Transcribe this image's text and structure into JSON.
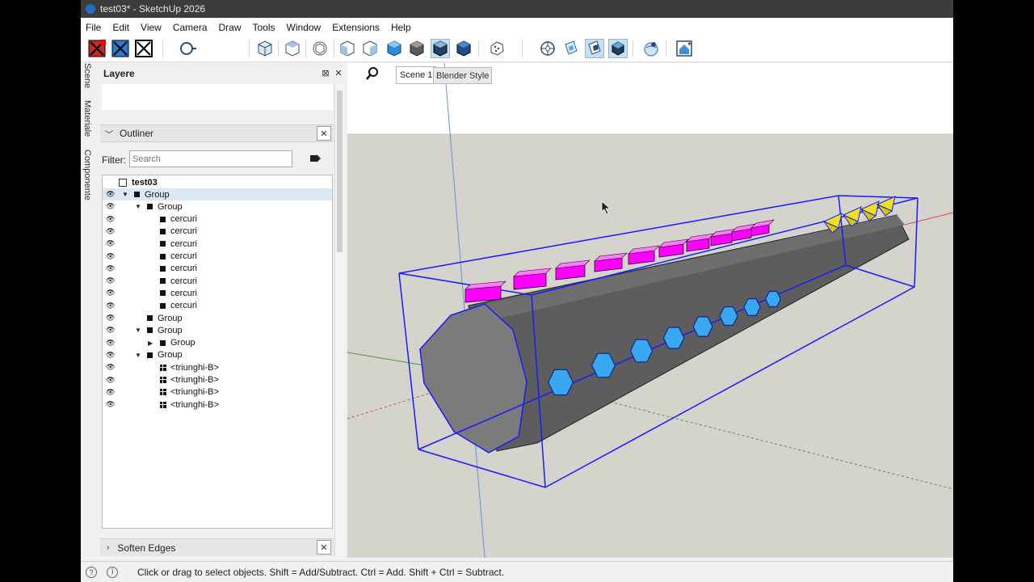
{
  "window": {
    "title": "test03* - SketchUp 2026"
  },
  "menu": [
    "File",
    "Edit",
    "View",
    "Camera",
    "Draw",
    "Tools",
    "Window",
    "Extensions",
    "Help"
  ],
  "toolbar": {
    "icons": [
      "xray-red-icon",
      "xray-blue-icon",
      "xray-black-icon",
      "orbit-icon",
      "iso-view-icon",
      "top-view-icon",
      "front-view-icon",
      "right-view-icon",
      "back-view-icon",
      "left-view-icon",
      "bottom-view-icon",
      "wireframe-style-icon",
      "shaded-style-icon",
      "textured-style-icon",
      "monochrome-style-icon",
      "section-plane-icon",
      "display-section-icon",
      "section-cut-icon",
      "section-fill-icon",
      "geo-location-icon",
      "warehouse-icon"
    ]
  },
  "sidetabs": [
    "Scene",
    "Materiale",
    "Componente"
  ],
  "tray": {
    "layers_title": "Layere",
    "outliner_title": "Outliner",
    "filter_label": "Filter:",
    "filter_placeholder": "Search",
    "soften_title": "Soften Edges",
    "close_glyph": "✕",
    "pin_glyph": "⊠"
  },
  "outliner": {
    "root": "test03",
    "rows": [
      {
        "label": "Group",
        "depth": 0,
        "twisty": "open",
        "icon": "group",
        "selected": true
      },
      {
        "label": "Group",
        "depth": 1,
        "twisty": "open",
        "icon": "group"
      },
      {
        "label": "cercuri",
        "depth": 2,
        "twisty": "none",
        "icon": "group"
      },
      {
        "label": "cercuri",
        "depth": 2,
        "twisty": "none",
        "icon": "group"
      },
      {
        "label": "cercuri",
        "depth": 2,
        "twisty": "none",
        "icon": "group"
      },
      {
        "label": "cercuri",
        "depth": 2,
        "twisty": "none",
        "icon": "group"
      },
      {
        "label": "cercuri",
        "depth": 2,
        "twisty": "none",
        "icon": "group"
      },
      {
        "label": "cercuri",
        "depth": 2,
        "twisty": "none",
        "icon": "group"
      },
      {
        "label": "cercuri",
        "depth": 2,
        "twisty": "none",
        "icon": "group"
      },
      {
        "label": "cercuri",
        "depth": 2,
        "twisty": "none",
        "icon": "group"
      },
      {
        "label": "Group",
        "depth": 1,
        "twisty": "none",
        "icon": "group"
      },
      {
        "label": "Group",
        "depth": 1,
        "twisty": "open",
        "icon": "group"
      },
      {
        "label": "Group",
        "depth": 2,
        "twisty": "closed",
        "icon": "group"
      },
      {
        "label": "Group",
        "depth": 1,
        "twisty": "open",
        "icon": "group"
      },
      {
        "label": "<triunghi-B>",
        "depth": 2,
        "twisty": "none",
        "icon": "component"
      },
      {
        "label": "<triunghi-B>",
        "depth": 2,
        "twisty": "none",
        "icon": "component"
      },
      {
        "label": "<triunghi-B>",
        "depth": 2,
        "twisty": "none",
        "icon": "component"
      },
      {
        "label": "<triunghi-B>",
        "depth": 2,
        "twisty": "none",
        "icon": "component"
      }
    ]
  },
  "scenes": {
    "tabs": [
      "Scene 1",
      "Blender Style"
    ],
    "active": "Scene 1"
  },
  "model": {
    "colors": {
      "sky": "#ffffff",
      "ground": "#d4d4cc",
      "cylinder": "#5d5d5d",
      "cylinder_cap": "#7b7b7b",
      "bbox": "#1a1aff",
      "magenta": "#ff00ff",
      "cyan": "#3aa8f0",
      "yellow": "#f0e21a"
    }
  },
  "status": {
    "text": "Click or drag to select objects. Shift = Add/Subtract. Ctrl = Add. Shift + Ctrl = Subtract."
  }
}
